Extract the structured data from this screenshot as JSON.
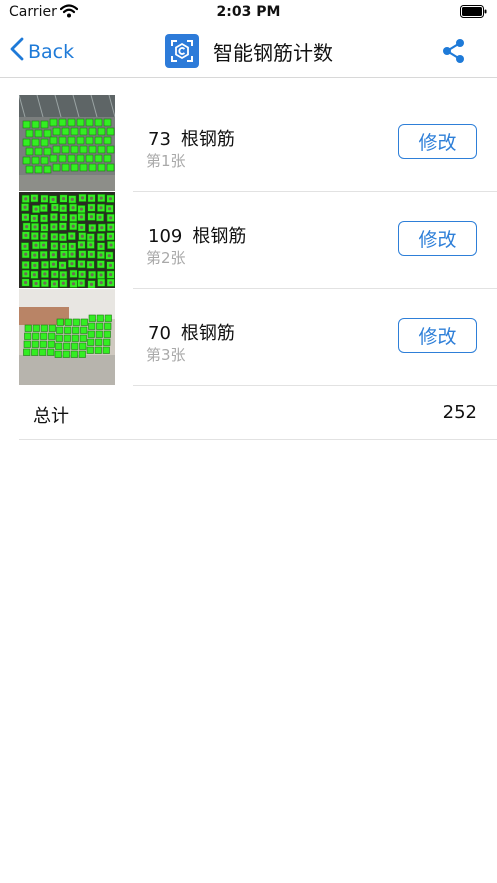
{
  "status_bar": {
    "carrier": "Carrier",
    "time": "2:03 PM"
  },
  "nav": {
    "back_label": "Back",
    "title": "智能钢筋计数"
  },
  "colors": {
    "accent": "#2e7fd8",
    "marker_green": "#33ee22",
    "logo_bg": "#2d7bd9"
  },
  "icons": {
    "back": "chevron-left-icon",
    "logo": "app-logo-icon",
    "share": "share-icon"
  },
  "rows": [
    {
      "count": "73",
      "unit": "根钢筋",
      "sheet": "第1张",
      "button": "修改"
    },
    {
      "count": "109",
      "unit": "根钢筋",
      "sheet": "第2张",
      "button": "修改"
    },
    {
      "count": "70",
      "unit": "根钢筋",
      "sheet": "第3张",
      "button": "修改"
    }
  ],
  "total": {
    "label": "总计",
    "value": "252"
  }
}
